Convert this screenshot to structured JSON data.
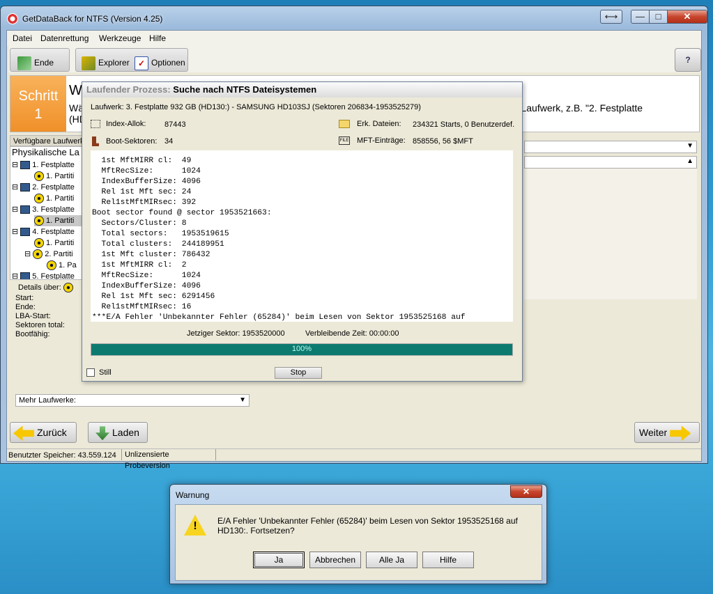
{
  "window": {
    "title": "GetDataBack for NTFS (Version 4.25)",
    "restore": "⟷",
    "minimize": "—",
    "maximize": "□",
    "close": "✕"
  },
  "menu": [
    "Datei",
    "Datenrettung",
    "Werkzeuge",
    "Hilfe"
  ],
  "toolbar": {
    "exit": "Ende",
    "explorer": "Explorer",
    "options": "Optionen",
    "help": "?"
  },
  "step": {
    "badge_line1": "Schritt",
    "badge_line2": "1",
    "heading": "W",
    "desc_left": "Wä",
    "desc_left2": "(HD",
    "desc_right": "che Laufwerk, z.B. \"2. Festplatte"
  },
  "drives": {
    "header": "Verfügbare Laufwerke",
    "title": "Physikalische La",
    "rows": [
      "1. Festplatte",
      "1. Partiti",
      "2. Festplatte",
      "1. Partiti",
      "3. Festplatte",
      "1. Partiti",
      "4. Festplatte",
      "1. Partiti",
      "2. Partiti",
      "1. Pa",
      "5. Festplatte"
    ]
  },
  "details": {
    "header": "Details über:",
    "start": "Start:",
    "end": "Ende:",
    "lba": "LBA-Start:",
    "sectors": "Sektoren total:",
    "bootable": "Bootfähig:"
  },
  "more_drives": "Mehr Laufwerke:",
  "nav": {
    "back": "Zurück",
    "load": "Laden",
    "next": "Weiter"
  },
  "status": {
    "memory": "Benutzter Speicher: 43.559.124",
    "license": "Unlizensierte Probeversion"
  },
  "process": {
    "title_prefix": "Laufender Prozess:",
    "title_main": "Suche nach NTFS Dateisystemen",
    "drive": "Laufwerk: 3. Festplatte 932 GB (HD130:) - SAMSUNG HD103SJ (Sektoren 206834-1953525279)",
    "index_alloc_label": "Index-Allok:",
    "index_alloc_value": "87443",
    "found_files_label": "Erk. Dateien:",
    "found_files_value": "234321 Starts, 0 Benutzerdef.",
    "boot_sectors_label": "Boot-Sektoren:",
    "boot_sectors_value": "34",
    "mft_label": "MFT-Einträge:",
    "mft_value": "858556, 56 $MFT",
    "log": [
      "  1st MftMIRR cl:  49",
      "  MftRecSize:      1024",
      "  IndexBufferSize: 4096",
      "  Rel 1st Mft sec: 24",
      "  Rel1stMftMIRsec: 392",
      "Boot sector found @ sector 1953521663:",
      "  Sectors/Cluster: 8",
      "  Total sectors:   1953519615",
      "  Total clusters:  244189951",
      "  1st Mft cluster: 786432",
      "  1st MftMIRR cl:  2",
      "  MftRecSize:      1024",
      "  IndexBufferSize: 4096",
      "  Rel 1st Mft sec: 6291456",
      "  Rel1stMftMIRsec: 16",
      "***E/A Fehler 'Unbekannter Fehler (65284)' beim Lesen von Sektor 1953525168 auf"
    ],
    "current_sector": "Jetziger Sektor:  1953520000",
    "remaining": "Verbleibende Zeit: 00:00:00",
    "progress": 1.0,
    "progress_text": "100%",
    "still": "Still",
    "stop": "Stop"
  },
  "warning": {
    "title": "Warnung",
    "close": "✕",
    "message": "E/A Fehler 'Unbekannter Fehler (65284)' beim Lesen von Sektor 1953525168 auf HD130:. Fortsetzen?",
    "buttons": {
      "yes": "Ja",
      "abort": "Abbrechen",
      "yes_all": "Alle Ja",
      "help": "Hilfe"
    }
  }
}
